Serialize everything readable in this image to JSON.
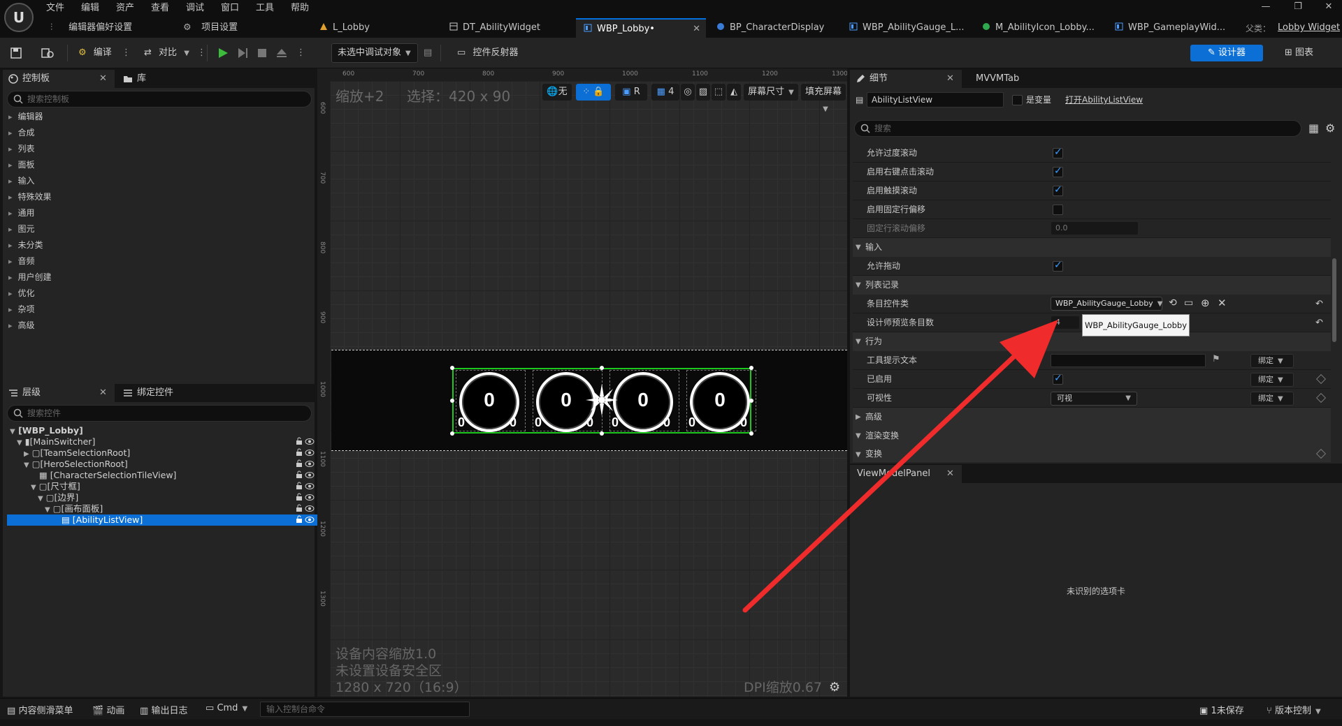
{
  "menu": {
    "items": [
      "文件",
      "编辑",
      "资产",
      "查看",
      "调试",
      "窗口",
      "工具",
      "帮助"
    ],
    "sub_items": [
      "编辑器偏好设置",
      "项目设置"
    ]
  },
  "tabs": [
    {
      "label": "L_Lobby"
    },
    {
      "label": "DT_AbilityWidget"
    },
    {
      "label": "WBP_Lobby•"
    },
    {
      "label": "BP_CharacterDisplay"
    },
    {
      "label": "WBP_AbilityGauge_L..."
    },
    {
      "label": "M_AbilityIcon_Lobby..."
    },
    {
      "label": "WBP_GameplayWid..."
    }
  ],
  "parent_class": {
    "label": "父类：",
    "value": "Lobby Widget"
  },
  "toolbar": {
    "compile_label": "编译",
    "diff_label": "对比",
    "debug_target": "未选中调试对象",
    "reflector_label": "控件反射器",
    "designer_label": "设计器",
    "graph_label": "图表"
  },
  "palette": {
    "tab_label": "控制板",
    "library_tab": "库",
    "search_placeholder": "搜索控制板",
    "categories": [
      "编辑器",
      "合成",
      "列表",
      "面板",
      "输入",
      "特殊效果",
      "通用",
      "图元",
      "未分类",
      "音频",
      "用户创建",
      "优化",
      "杂项",
      "高级"
    ]
  },
  "hierarchy": {
    "tab_label": "层级",
    "bind_tab": "绑定控件",
    "search_placeholder": "搜索控件",
    "rows": [
      {
        "label": "[WBP_Lobby]"
      },
      {
        "label": "[MainSwitcher]"
      },
      {
        "label": "[TeamSelectionRoot]"
      },
      {
        "label": "[HeroSelectionRoot]"
      },
      {
        "label": "[CharacterSelectionTileView]"
      },
      {
        "label": "[尺寸框]"
      },
      {
        "label": "[边界]"
      },
      {
        "label": "[画布面板]"
      },
      {
        "label": "[AbilityListView]"
      }
    ]
  },
  "viewport": {
    "zoom_label": "缩放+2",
    "selection_label": "选择：420 x 90",
    "none_label": "无",
    "r_label": "R",
    "grid_count": "4",
    "screen_size": "屏幕尺寸",
    "fill_screen": "填充屏幕",
    "device_scale": "设备内容缩放1.0",
    "safe_zone": "未设置设备安全区",
    "resolution": "1280 x 720（16:9）",
    "dpi": "DPI缩放0.67",
    "ruler_top": [
      "600",
      "700",
      "800",
      "900",
      "1000",
      "1100",
      "1200",
      "1300"
    ],
    "ruler_left": [
      "600",
      "700",
      "800",
      "900",
      "1000",
      "1100",
      "1200",
      "1300"
    ],
    "gauges": [
      {
        "main": "0",
        "left": "0",
        "right": "0"
      },
      {
        "main": "0",
        "left": "0",
        "right": "0"
      },
      {
        "main": "0",
        "left": "0",
        "right": "0"
      },
      {
        "main": "0",
        "left": "0",
        "right": "0"
      }
    ]
  },
  "details": {
    "tab_label": "细节",
    "mvvm_tab": "MVVMTab",
    "widget_name": "AbilityListView",
    "is_variable_label": "是变量",
    "open_link": "打开AbilityListView",
    "search_placeholder": "搜索",
    "rows": {
      "allow_overscroll": "允许过度滚动",
      "enable_rmb_scroll": "启用右键点击滚动",
      "enable_touch_scroll": "启用触摸滚动",
      "enable_fixed_offset": "启用固定行偏移",
      "fixed_offset": "固定行滚动偏移",
      "fixed_offset_value": "0.0",
      "input_header": "输入",
      "allow_drag": "允许拖动",
      "list_entries_header": "列表记录",
      "entry_widget_class": "条目控件类",
      "entry_widget_value": "WBP_AbilityGauge_Lobby",
      "preview_count": "设计师预览条目数",
      "preview_value": "4",
      "tooltip_value": "WBP_AbilityGauge_Lobby",
      "behavior_header": "行为",
      "tooltip_text": "工具提示文本",
      "enabled": "已启用",
      "visibility": "可视性",
      "visibility_value": "可视",
      "bind_label": "绑定",
      "advanced_header": "高级",
      "render_transform_header": "渲染变换",
      "transform_header": "变换"
    }
  },
  "viewmodel": {
    "tab_label": "ViewModelPanel",
    "message": "未识别的选项卡"
  },
  "statusbar": {
    "content_drawer": "内容侧滑菜单",
    "animation": "动画",
    "output_log": "输出日志",
    "cmd": "Cmd",
    "console_placeholder": "输入控制台命令",
    "unsaved": "1未保存",
    "source_control": "版本控制"
  },
  "colors": {
    "accent": "#0b6fd6",
    "selection_green": "#1ec81e",
    "arrow_red": "#ef2b2b"
  }
}
